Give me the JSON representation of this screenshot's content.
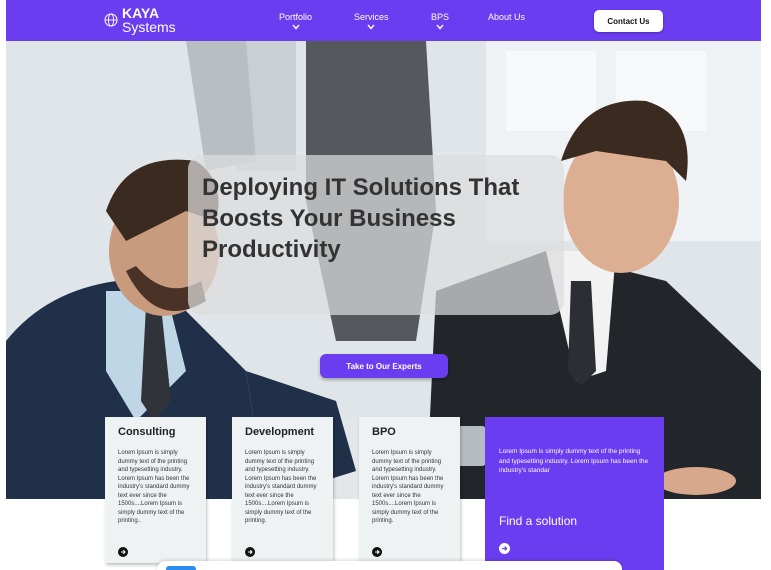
{
  "brand": {
    "name_top": "KAYA",
    "name_bottom": "Systems"
  },
  "nav": {
    "items": [
      {
        "label": "Portfolio",
        "has_dropdown": true
      },
      {
        "label": "Services",
        "has_dropdown": true
      },
      {
        "label": "BPS",
        "has_dropdown": true
      },
      {
        "label": "About Us",
        "has_dropdown": false
      }
    ],
    "contact_label": "Contact Us"
  },
  "hero": {
    "headline_line1": "Deploying IT Solutions That",
    "headline_line2": "Boosts Your Business",
    "headline_line3": "Productivity",
    "cta_label": "Take to Our Experts"
  },
  "cards": [
    {
      "title": "Consulting",
      "text": "Lorem Ipsum is simply dummy text of the printing and typesetting industry. Lorem Ipsum has been the industry's standard dummy text ever since the 1500s....Lorem Ipsum is simply dummy text of the printing.."
    },
    {
      "title": "Development",
      "text": "Lorem Ipsum is simply dummy text of the printing and typesetting industry. Lorem Ipsum has been the industry's standard dummy text ever since the 1500s....Lorem Ipsum is simply dummy text of the printing."
    },
    {
      "title": "BPO",
      "text": "Lorem Ipsum is simply dummy text of the printing and typesetting industry. Lorem Ipsum has been the industry's standard dummy text ever since the 1500s....Lorem Ipsum is simply dummy text of the printing."
    }
  ],
  "solution_card": {
    "text": "Lorem Ipsum is simply dummy text of the printing and typesetting industry. Lorem Ipsum has been the industry's standar",
    "cta_label": "Find a solution"
  },
  "colors": {
    "brand": "#6a3df0",
    "card_bg": "#eef2f3",
    "text_dark": "#333333"
  },
  "icons": {
    "logo": "globe-icon",
    "dropdown": "chevron-down-icon",
    "card_link": "arrow-circle-icon"
  }
}
